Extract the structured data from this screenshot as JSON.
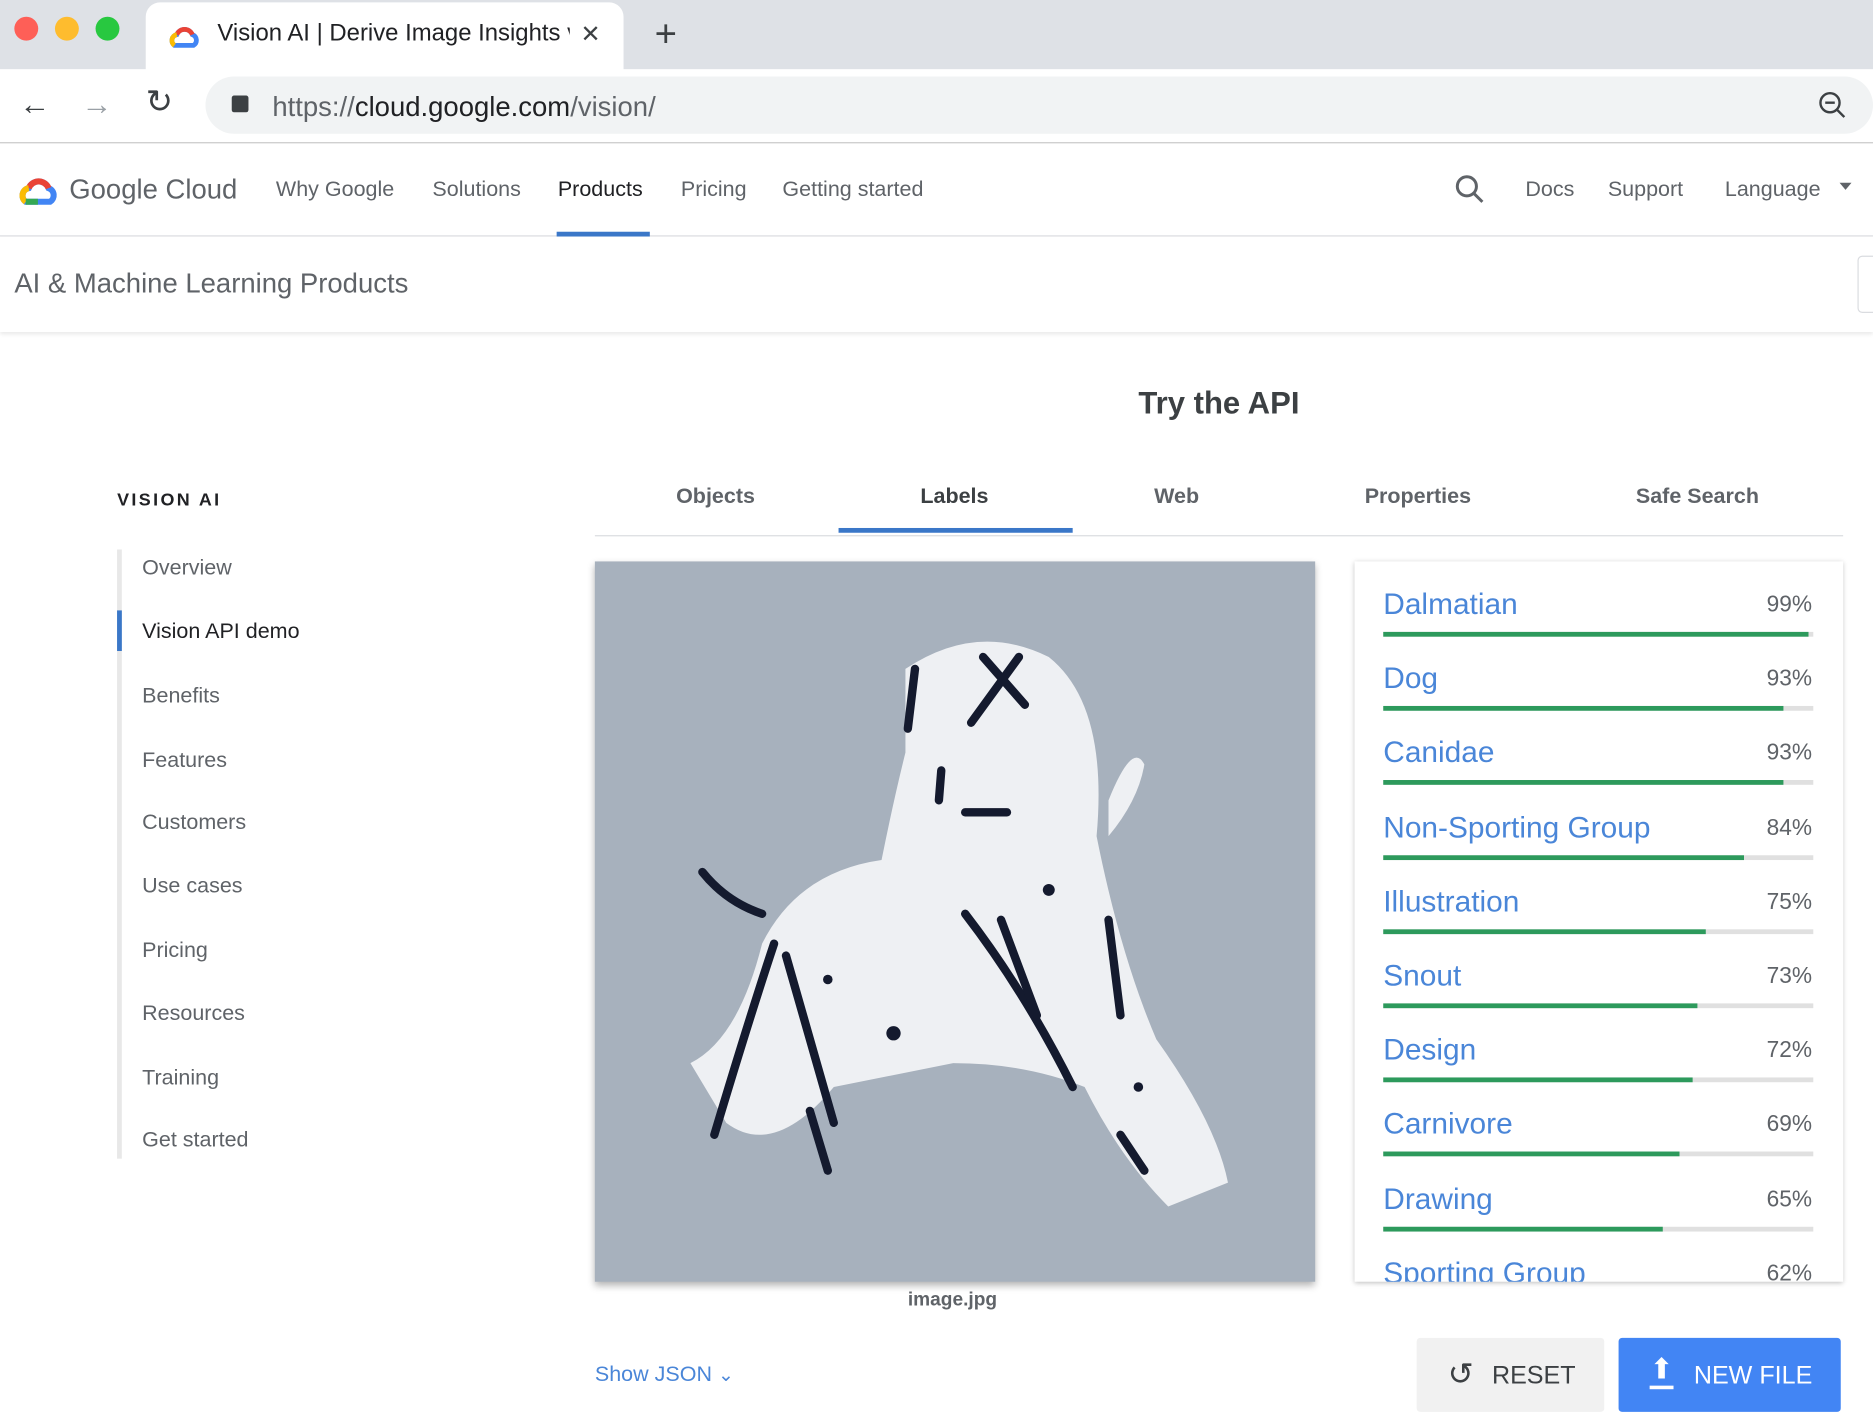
{
  "browser": {
    "tab_title": "Vision AI | Derive Image Insights via ML",
    "url_scheme": "https://",
    "url_host": "cloud.google.com",
    "url_path": "/vision/",
    "new_tab": "+",
    "close": "✕"
  },
  "nav": {
    "logo": "Google Cloud",
    "links": [
      "Why Google",
      "Solutions",
      "Products",
      "Pricing",
      "Getting started"
    ],
    "active": "Products",
    "right": [
      "Docs",
      "Support",
      "Language"
    ]
  },
  "subheader": {
    "title": "AI & Machine Learning Products"
  },
  "sidebar": {
    "heading": "VISION AI",
    "items": [
      "Overview",
      "Vision API demo",
      "Benefits",
      "Features",
      "Customers",
      "Use cases",
      "Pricing",
      "Resources",
      "Training",
      "Get started"
    ],
    "active": "Vision API demo"
  },
  "demo": {
    "title": "Try the API",
    "tabs": [
      "Objects",
      "Labels",
      "Web",
      "Properties",
      "Safe Search"
    ],
    "active_tab": "Labels",
    "image_name": "image.jpg",
    "labels": [
      {
        "name": "Dalmatian",
        "pct": 99
      },
      {
        "name": "Dog",
        "pct": 93
      },
      {
        "name": "Canidae",
        "pct": 93
      },
      {
        "name": "Non-Sporting Group",
        "pct": 84
      },
      {
        "name": "Illustration",
        "pct": 75
      },
      {
        "name": "Snout",
        "pct": 73
      },
      {
        "name": "Design",
        "pct": 72
      },
      {
        "name": "Carnivore",
        "pct": 69
      },
      {
        "name": "Drawing",
        "pct": 65
      },
      {
        "name": "Sporting Group",
        "pct": 62
      }
    ],
    "show_json": "Show JSON",
    "reset": "RESET",
    "new_file": "NEW FILE"
  },
  "colors": {
    "accent": "#4285f4",
    "link": "#4a86d8",
    "bar": "#2d9a5c",
    "image_bg": "#a7b1bd"
  }
}
